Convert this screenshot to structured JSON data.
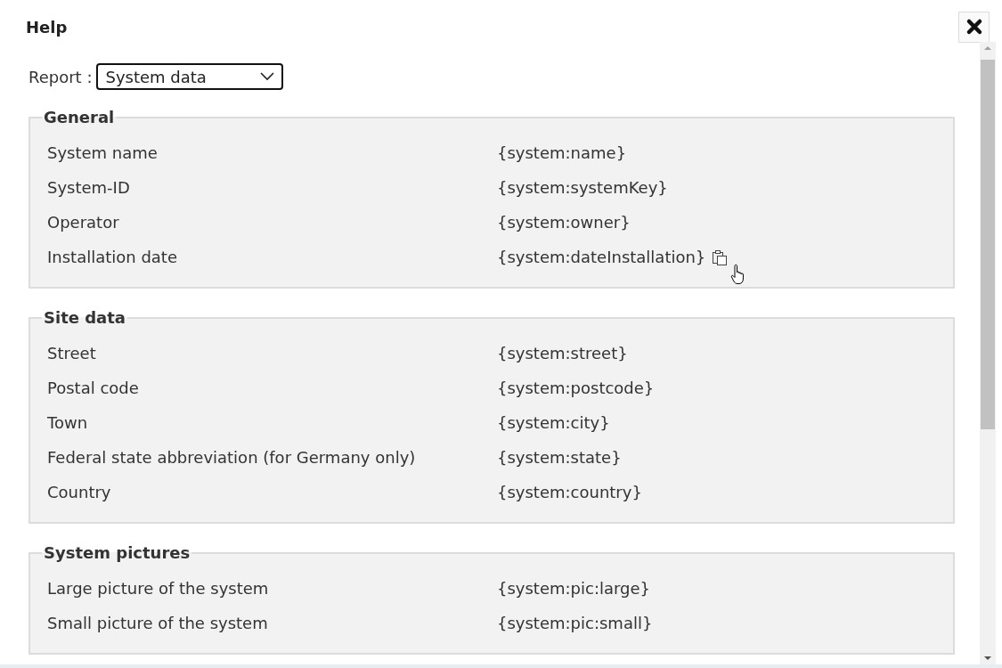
{
  "dialog": {
    "title": "Help"
  },
  "report": {
    "label": "Report :",
    "value": "System data"
  },
  "sections": [
    {
      "title": "General",
      "rows": [
        {
          "label": "System name",
          "value": "{system:name}",
          "hovered": false
        },
        {
          "label": "System-ID",
          "value": "{system:systemKey}",
          "hovered": false
        },
        {
          "label": "Operator",
          "value": "{system:owner}",
          "hovered": false
        },
        {
          "label": "Installation date",
          "value": "{system:dateInstallation}",
          "hovered": true
        }
      ]
    },
    {
      "title": "Site data",
      "rows": [
        {
          "label": "Street",
          "value": "{system:street}",
          "hovered": false
        },
        {
          "label": "Postal code",
          "value": "{system:postcode}",
          "hovered": false
        },
        {
          "label": "Town",
          "value": "{system:city}",
          "hovered": false
        },
        {
          "label": "Federal state abbreviation (for Germany only)",
          "value": "{system:state}",
          "hovered": false
        },
        {
          "label": "Country",
          "value": "{system:country}",
          "hovered": false
        }
      ]
    },
    {
      "title": "System pictures",
      "rows": [
        {
          "label": "Large picture of the system",
          "value": "{system:pic:large}",
          "hovered": false
        },
        {
          "label": "Small picture of the system",
          "value": "{system:pic:small}",
          "hovered": false
        }
      ]
    }
  ]
}
